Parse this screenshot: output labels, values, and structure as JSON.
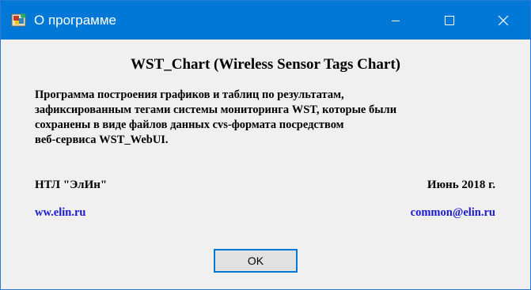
{
  "window": {
    "title": "О программе"
  },
  "icons": {
    "app": "app-icon",
    "minimize": "minimize-icon",
    "maximize": "maximize-icon",
    "close": "close-icon"
  },
  "colors": {
    "titlebar": "#0078d7",
    "background": "#f0f0f0",
    "link": "#1a1ad6"
  },
  "about": {
    "heading": "WST_Chart (Wireless Sensor Tags Chart)",
    "description_lines": [
      "Программа построения графиков и таблиц по результатам,",
      "зафиксированным тегами системы мониторинга WST, которые были",
      "сохранены в виде файлов данных cvs-формата посредством",
      "веб-сервиса WST_WebUI."
    ],
    "organization": "НТЛ \"ЭлИн\"",
    "date": "Июнь 2018 г.",
    "website": "ww.elin.ru",
    "email": "common@elin.ru"
  },
  "buttons": {
    "ok": "OK"
  }
}
